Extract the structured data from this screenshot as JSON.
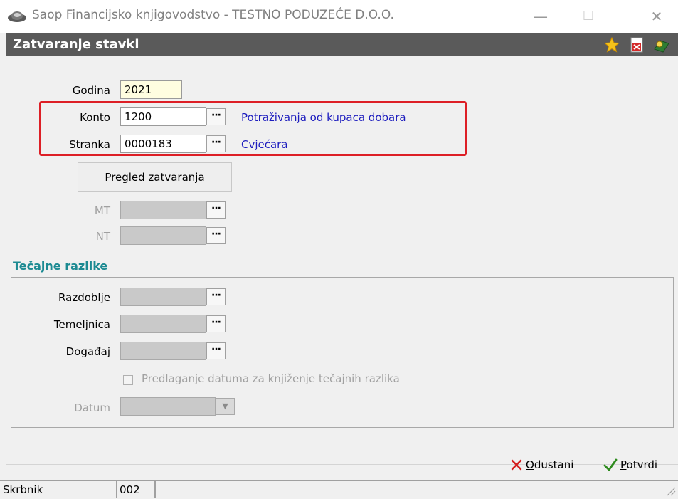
{
  "window": {
    "title": "Saop Financijsko knjigovodstvo - TESTNO PODUZEĆE D.O.O.",
    "minimize": "—",
    "maximize": "☐",
    "close": "✕"
  },
  "header": {
    "title": "Zatvaranje stavki",
    "icons": [
      "star-icon",
      "excel-export-icon",
      "help-icon"
    ]
  },
  "form": {
    "godina": {
      "label": "Godina",
      "value": "2021"
    },
    "konto": {
      "label": "Konto",
      "value": "1200",
      "description": "Potraživanja od kupaca dobara"
    },
    "stranka": {
      "label": "Stranka",
      "value": "0000183",
      "description": "Cvjećara"
    },
    "ellipsis": "···",
    "pregled_button": {
      "prefix": "Pregled ",
      "underlined": "z",
      "suffix": "atvaranja"
    },
    "mt": {
      "label": "MT",
      "value": ""
    },
    "nt": {
      "label": "NT",
      "value": ""
    }
  },
  "tecajne": {
    "title": "Tečajne razlike",
    "razdoblje": {
      "label": "Razdoblje",
      "value": ""
    },
    "temeljnica": {
      "label": "Temeljnica",
      "value": ""
    },
    "dogadaj": {
      "label": "Događaj",
      "value": ""
    },
    "checkbox_label": "Predlaganje datuma za knjiženje tečajnih razlika",
    "checked": false,
    "datum": {
      "label": "Datum",
      "value": ""
    },
    "combo_arrow": "▼"
  },
  "actions": {
    "odustani": {
      "underlined": "O",
      "rest": "dustani"
    },
    "potvrdi": {
      "underlined": "P",
      "rest": "otvrdi"
    }
  },
  "statusbar": {
    "label": "Skrbnik",
    "value": "002"
  },
  "colors": {
    "header_bg": "#5a5a5a",
    "link": "#1c1cbe",
    "section_title": "#1c8a92",
    "highlight_border": "#dd1f26",
    "cancel_icon": "#d41f1f",
    "confirm_icon": "#2e8b1e"
  }
}
